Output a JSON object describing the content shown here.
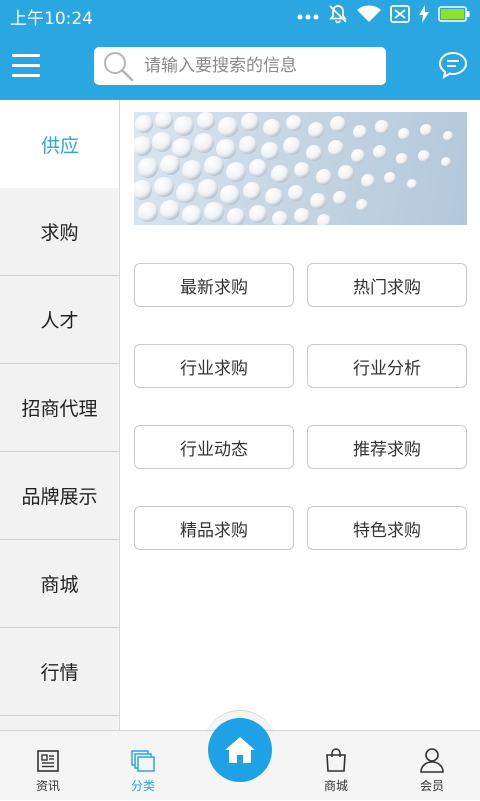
{
  "status_bar": {
    "time": "上午10:24",
    "icons": [
      "more-dots-icon",
      "muted-bell-icon",
      "wifi-icon",
      "sim-off-icon",
      "charging-icon",
      "battery-icon"
    ]
  },
  "header": {
    "menu_icon": "hamburger-menu-icon",
    "search": {
      "placeholder": "请输入要搜索的信息",
      "value": ""
    },
    "message_icon": "chat-bubble-icon"
  },
  "sidebar": {
    "items": [
      {
        "label": "供应",
        "active": true
      },
      {
        "label": "求购",
        "active": false
      },
      {
        "label": "人才",
        "active": false
      },
      {
        "label": "招商代理",
        "active": false
      },
      {
        "label": "品牌展示",
        "active": false
      },
      {
        "label": "商城",
        "active": false
      },
      {
        "label": "行情",
        "active": false
      }
    ]
  },
  "content": {
    "banner": "white-foam-beads-image",
    "buttons": [
      "最新求购",
      "热门求购",
      "行业求购",
      "行业分析",
      "行业动态",
      "推荐求购",
      "精品求购",
      "特色求购"
    ]
  },
  "bottom_nav": {
    "items": [
      {
        "label": "资讯",
        "icon": "news-icon",
        "active": false
      },
      {
        "label": "分类",
        "icon": "category-icon",
        "active": true
      },
      {
        "label": "",
        "icon": "home-icon",
        "active": false
      },
      {
        "label": "商城",
        "icon": "shopping-bag-icon",
        "active": false
      },
      {
        "label": "会员",
        "icon": "user-icon",
        "active": false
      }
    ]
  },
  "colors": {
    "primary": "#2aa6e0",
    "home_button": "#1da3e5",
    "sidebar_bg": "#f2f2f2",
    "text": "#222222"
  }
}
